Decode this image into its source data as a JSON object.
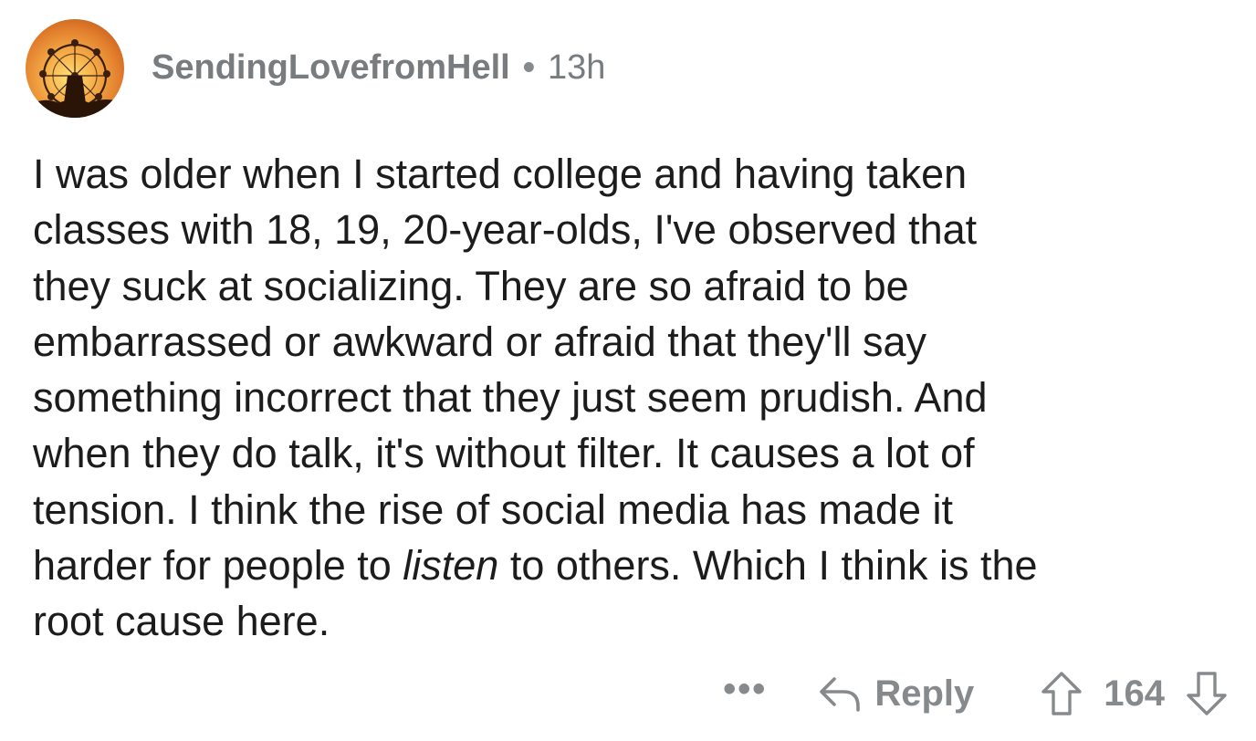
{
  "comment": {
    "author": "SendingLovefromHell",
    "separator": "•",
    "time": "13h",
    "avatar_icon": "ferris-wheel-sunset-avatar",
    "lines": [
      "I was older when I started college and having taken",
      "classes with 18, 19, 20-year-olds, I've observed that",
      "they suck at socializing. They are so afraid to be",
      "embarrassed or awkward or afraid that they'll say",
      "something incorrect that they just seem prudish. And",
      "when they do talk, it's without filter. It causes a lot of",
      "tension. I think the rise of social media has made it"
    ],
    "line8": {
      "before": "harder for people to ",
      "emphasis": "listen",
      "after": " to others. Which I think is the"
    },
    "line9": "root cause here."
  },
  "actions": {
    "more_label": "•••",
    "reply_label": "Reply",
    "score": "164",
    "upvote_icon": "upvote-arrow-icon",
    "downvote_icon": "downvote-arrow-icon",
    "reply_icon": "reply-arrow-icon",
    "icon_color": "#878a8c"
  }
}
